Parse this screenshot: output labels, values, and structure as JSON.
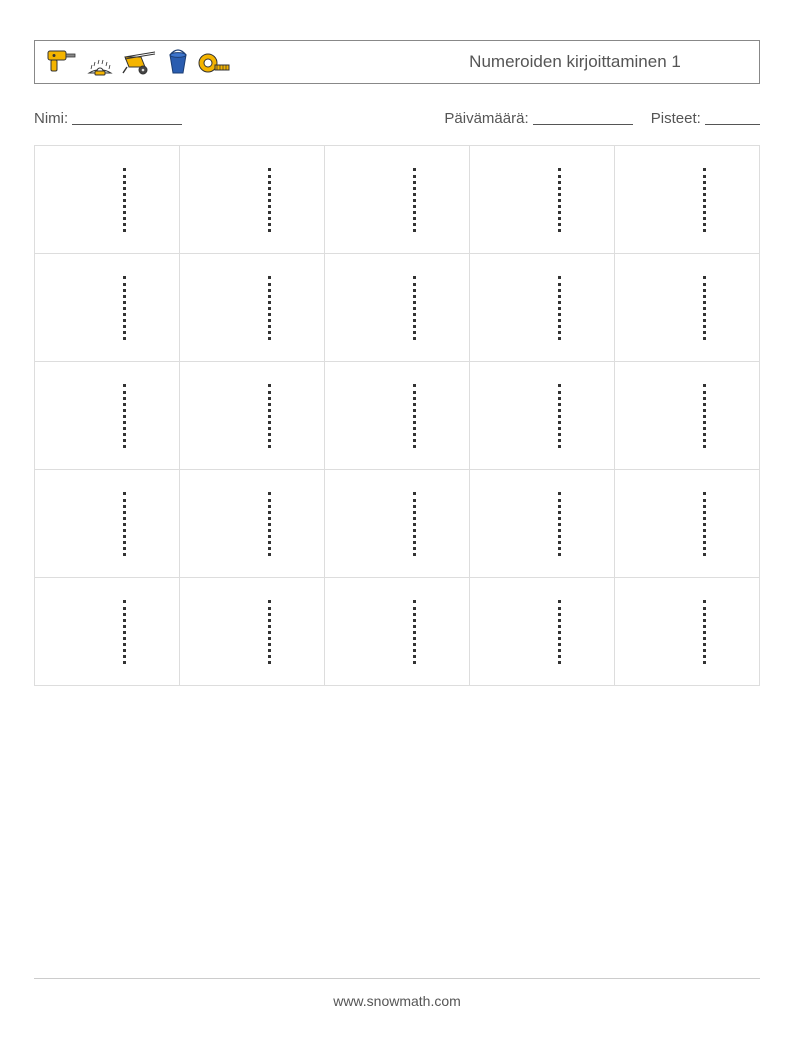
{
  "header": {
    "title": "Numeroiden kirjoittaminen 1",
    "icons": [
      "drill-icon",
      "saw-blade-icon",
      "wheelbarrow-icon",
      "bucket-icon",
      "tape-measure-icon"
    ]
  },
  "meta": {
    "name_label": "Nimi:",
    "date_label": "Päivämäärä:",
    "score_label": "Pisteet:"
  },
  "worksheet": {
    "rows": 5,
    "cols": 5,
    "glyph": "1"
  },
  "footer": {
    "url": "www.snowmath.com"
  }
}
